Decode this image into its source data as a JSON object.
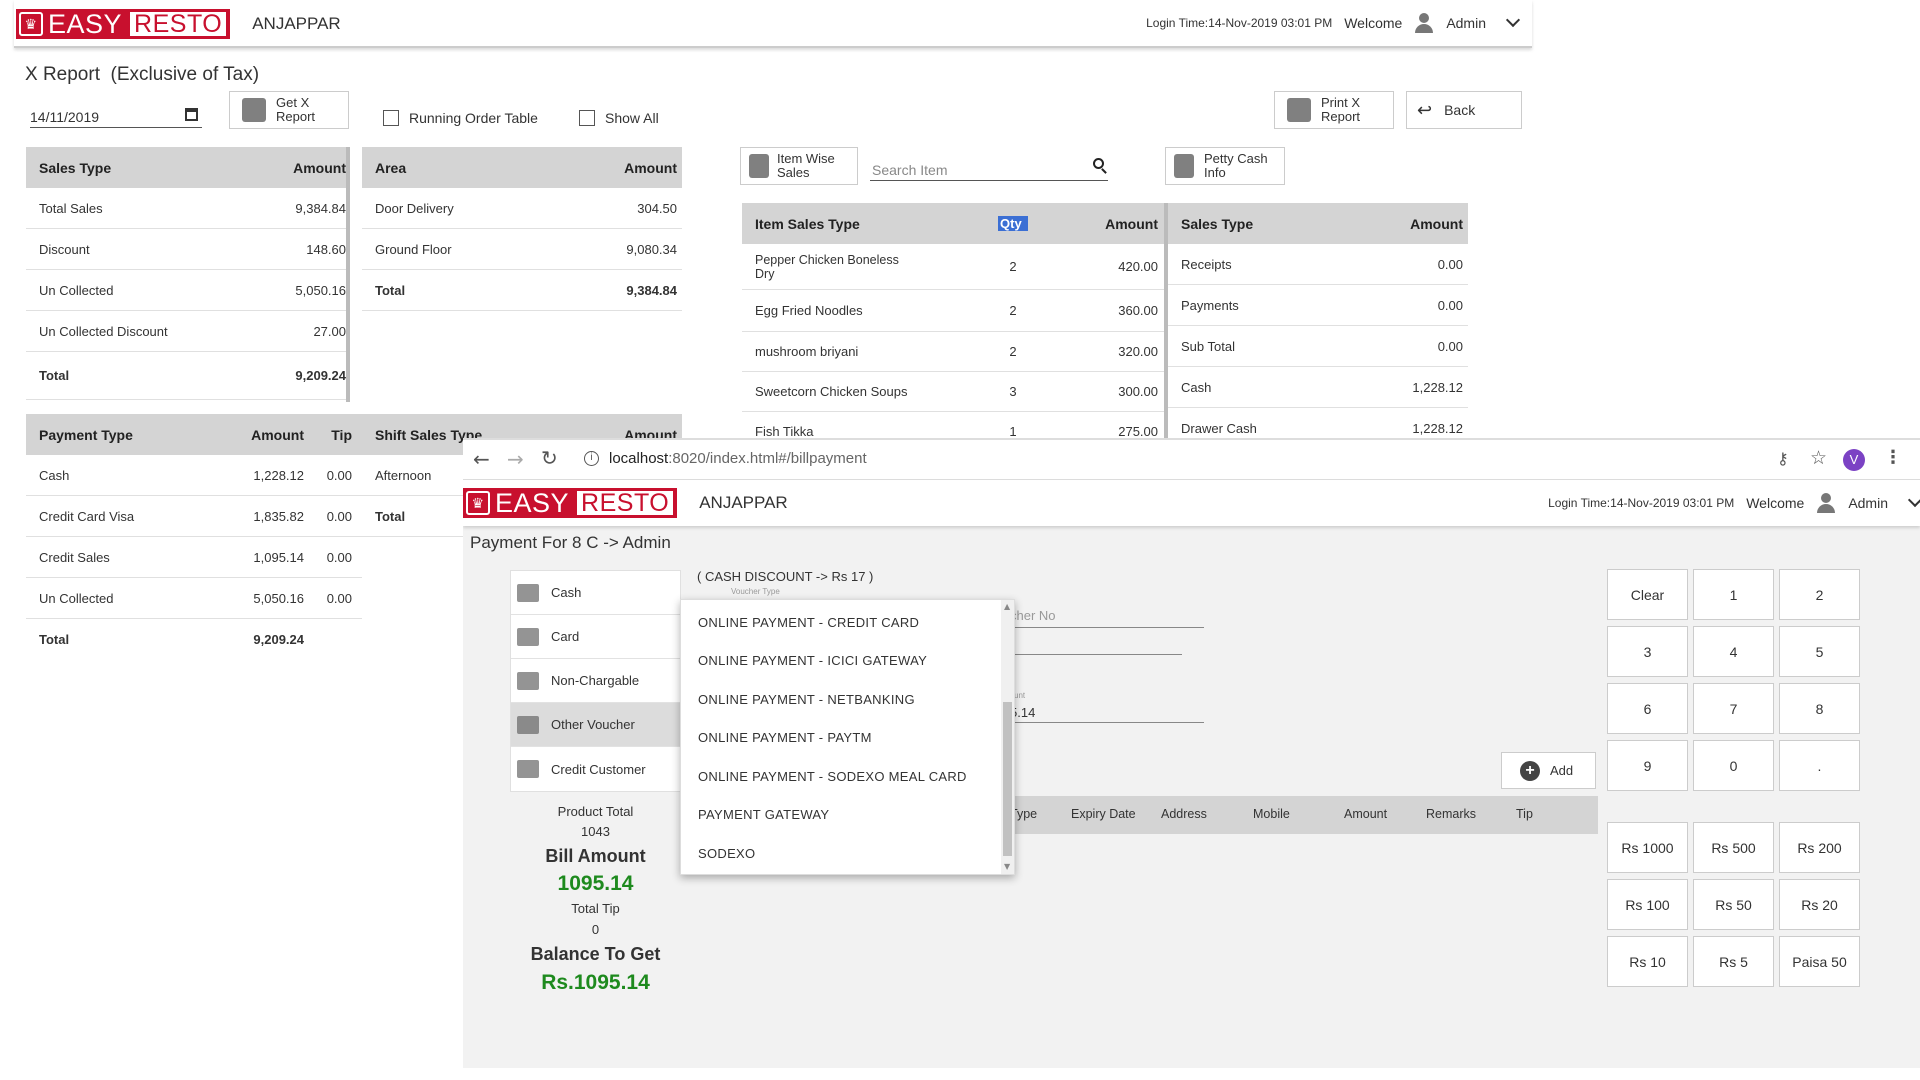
{
  "report": {
    "brand_easy": "EASY",
    "brand_resto": "RESTO",
    "restaurant": "ANJAPPAR",
    "login_time": "Login Time:14-Nov-2019 03:01 PM",
    "welcome": "Welcome",
    "user": "Admin",
    "title": "X Report  (Exclusive of Tax)",
    "date": "14/11/2019",
    "get_x_report": "Get X\nReport",
    "running_order_table": "Running Order Table",
    "show_all": "Show All",
    "print_x_report": "Print X\nReport",
    "back": "Back",
    "item_wise_sales": "Item Wise\nSales",
    "search_placeholder": "Search Item",
    "petty_cash_info": "Petty Cash\nInfo",
    "sales_type": {
      "headers": [
        "Sales Type",
        "Amount"
      ],
      "rows": [
        [
          "Total Sales",
          "9,384.84"
        ],
        [
          "Discount",
          "148.60"
        ],
        [
          "Un Collected",
          "5,050.16"
        ],
        [
          "Un Collected Discount",
          "27.00"
        ],
        [
          "Total",
          "9,209.24"
        ]
      ]
    },
    "area": {
      "headers": [
        "Area",
        "Amount"
      ],
      "rows": [
        [
          "Door Delivery",
          "304.50"
        ],
        [
          "Ground Floor",
          "9,080.34"
        ],
        [
          "Total",
          "9,384.84"
        ]
      ]
    },
    "payment_type": {
      "headers": [
        "Payment Type",
        "Amount",
        "Tip"
      ],
      "rows": [
        [
          "Cash",
          "1,228.12",
          "0.00"
        ],
        [
          "Credit Card Visa",
          "1,835.82",
          "0.00"
        ],
        [
          "Credit Sales",
          "1,095.14",
          "0.00"
        ],
        [
          "Un Collected",
          "5,050.16",
          "0.00"
        ],
        [
          "Total",
          "9,209.24",
          ""
        ]
      ]
    },
    "shift_sales": {
      "headers": [
        "Shift Sales Type",
        "Amount"
      ],
      "rows": [
        [
          "Afternoon",
          ""
        ],
        [
          "Total",
          ""
        ]
      ]
    },
    "item_sales": {
      "headers": [
        "Item Sales Type",
        "Qty",
        "Amount"
      ],
      "rows": [
        [
          "Pepper Chicken Boneless\nDry",
          "2",
          "420.00"
        ],
        [
          "Egg Fried Noodles",
          "2",
          "360.00"
        ],
        [
          "mushroom briyani",
          "2",
          "320.00"
        ],
        [
          "Sweetcorn Chicken Soups",
          "3",
          "300.00"
        ],
        [
          "Fish Tikka",
          "1",
          "275.00"
        ]
      ]
    },
    "sales_type2": {
      "headers": [
        "Sales Type",
        "Amount"
      ],
      "rows": [
        [
          "Receipts",
          "0.00"
        ],
        [
          "Payments",
          "0.00"
        ],
        [
          "Sub Total",
          "0.00"
        ],
        [
          "Cash",
          "1,228.12"
        ],
        [
          "Drawer Cash",
          "1,228.12"
        ]
      ]
    }
  },
  "browser": {
    "url_host": "localhost",
    "url_rest": ":8020/index.html#/billpayment",
    "profile_initial": "V"
  },
  "payment": {
    "brand_easy": "EASY",
    "brand_resto": "RESTO",
    "restaurant": "ANJAPPAR",
    "login_time": "Login Time:14-Nov-2019 03:01 PM",
    "welcome": "Welcome",
    "user": "Admin",
    "title": "Payment For 8 C -> Admin",
    "cash_discount": "( CASH DISCOUNT -> Rs 17 )",
    "voucher_type_label": "Voucher Type",
    "voucher_no_placeholder": "cher No",
    "amount_label": "unt",
    "amount_value": "5.14",
    "add": "Add",
    "methods": [
      "Cash",
      "Card",
      "Non-Chargable",
      "Other Voucher",
      "Credit Customer"
    ],
    "dropdown": [
      "ONLINE PAYMENT - CREDIT CARD",
      "ONLINE PAYMENT - ICICI GATEWAY",
      "ONLINE PAYMENT - NETBANKING",
      "ONLINE PAYMENT - PAYTM",
      "ONLINE PAYMENT - SODEXO MEAL CARD",
      "PAYMENT GATEWAY",
      "SODEXO"
    ],
    "table_headers": [
      "Type",
      "Expiry Date",
      "Address",
      "Mobile",
      "Amount",
      "Remarks",
      "Tip"
    ],
    "product_total_label": "Product Total",
    "product_total": "1043",
    "bill_amount_label": "Bill Amount",
    "bill_amount": "1095.14",
    "total_tip_label": "Total Tip",
    "total_tip": "0",
    "balance_label": "Balance To Get",
    "balance": "Rs.1095.14",
    "keypad": [
      "Clear",
      "1",
      "2",
      "3",
      "4",
      "5",
      "6",
      "7",
      "8",
      "9",
      "0",
      "."
    ],
    "money": [
      "Rs 1000",
      "Rs 500",
      "Rs 200",
      "Rs 100",
      "Rs 50",
      "Rs 20",
      "Rs 10",
      "Rs 5",
      "Paisa 50"
    ]
  },
  "colors": {
    "brand_red": "#c8102e",
    "green": "#1e8a1e",
    "profile": "#7b42c4",
    "header_grey": "#d4d4d4"
  }
}
